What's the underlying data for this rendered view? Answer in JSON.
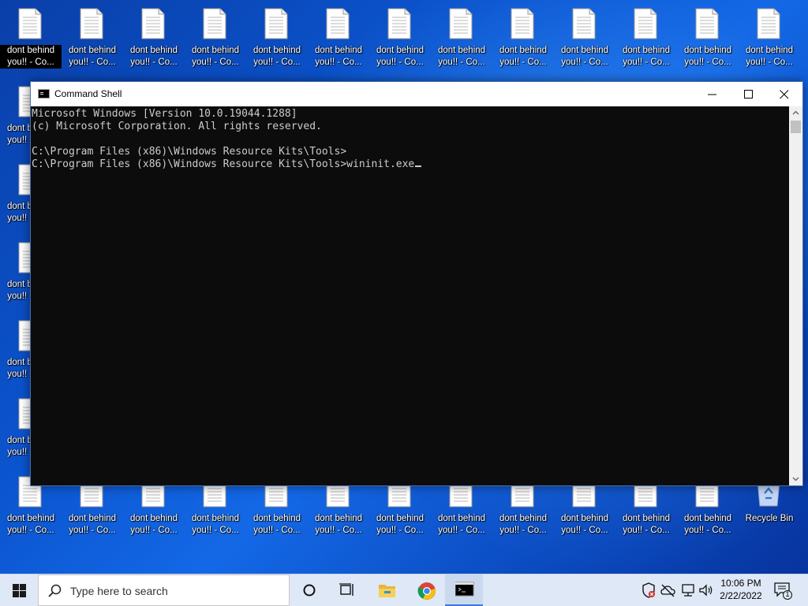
{
  "desktop": {
    "file_label_line1": "dont behind",
    "file_label_line2": "you!! - Co...",
    "selected_label_line1": "dont behind",
    "selected_label_line2": "you!! - Co...",
    "recycle_bin": "Recycle Bin"
  },
  "window": {
    "title": "Command Shell",
    "console_lines": [
      "Microsoft Windows [Version 10.0.19044.1288]",
      "(c) Microsoft Corporation. All rights reserved.",
      "",
      "C:\\Program Files (x86)\\Windows Resource Kits\\Tools>",
      "C:\\Program Files (x86)\\Windows Resource Kits\\Tools>wininit.exe"
    ]
  },
  "taskbar": {
    "search_placeholder": "Type here to search",
    "time": "10:06 PM",
    "date": "2/22/2022",
    "notification_count": "1"
  },
  "icons": {
    "start": "windows-logo-icon",
    "search": "search-icon",
    "cortana": "cortana-circle-icon",
    "task_view": "task-view-icon",
    "explorer": "file-explorer-icon",
    "chrome": "chrome-icon",
    "cmd": "command-prompt-icon"
  },
  "colors": {
    "console_bg": "#0c0c0c",
    "console_text": "#cccccc",
    "taskbar_bg": "#dfe8f6"
  }
}
